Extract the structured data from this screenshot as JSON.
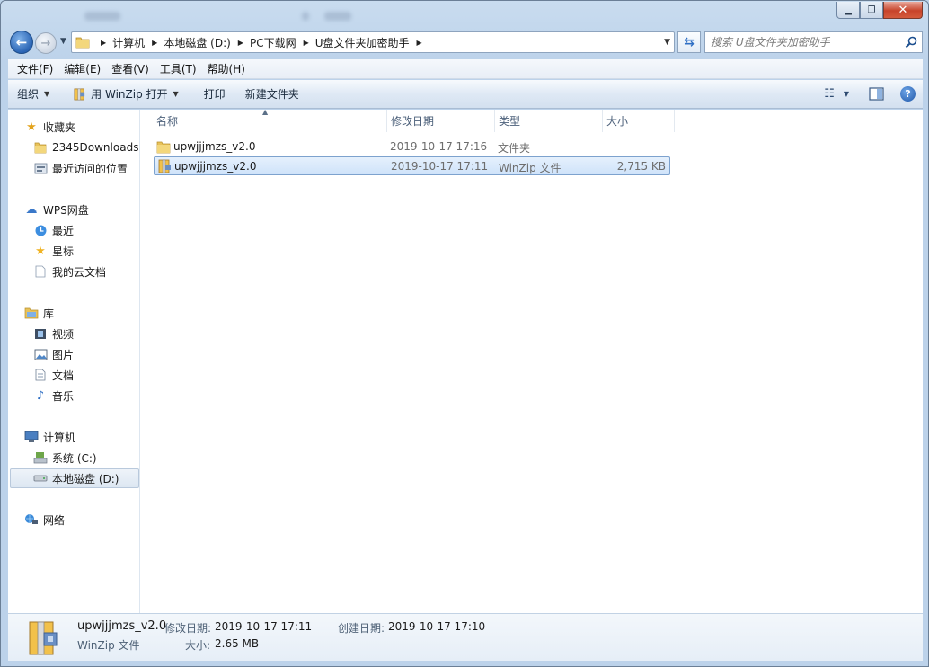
{
  "address": {
    "crumbs": [
      "计算机",
      "本地磁盘 (D:)",
      "PC下载网",
      "U盘文件夹加密助手"
    ]
  },
  "search": {
    "placeholder": "搜索 U盘文件夹加密助手"
  },
  "menubar": [
    "文件(F)",
    "编辑(E)",
    "查看(V)",
    "工具(T)",
    "帮助(H)"
  ],
  "toolbar": {
    "organize": "组织",
    "open_with": "用 WinZip 打开",
    "print": "打印",
    "new_folder": "新建文件夹"
  },
  "navpane": {
    "favorites": "收藏夹",
    "downloads": "2345Downloads",
    "recent_places": "最近访问的位置",
    "wps": "WPS网盘",
    "wps_recent": "最近",
    "wps_starred": "星标",
    "wps_docs": "我的云文档",
    "libraries": "库",
    "videos": "视频",
    "pictures": "图片",
    "documents": "文档",
    "music": "音乐",
    "computer": "计算机",
    "drive_c": "系统 (C:)",
    "drive_d": "本地磁盘 (D:)",
    "network": "网络"
  },
  "columns": {
    "name": "名称",
    "modified": "修改日期",
    "type": "类型",
    "size": "大小"
  },
  "files": [
    {
      "name": "upwjjjmzs_v2.0",
      "modified": "2019-10-17 17:16",
      "type": "文件夹",
      "size": "",
      "icon": "folder-icon"
    },
    {
      "name": "upwjjjmzs_v2.0",
      "modified": "2019-10-17 17:11",
      "type": "WinZip 文件",
      "size": "2,715 KB",
      "icon": "winzip-icon"
    }
  ],
  "details": {
    "name": "upwjjjmzs_v2.0",
    "type": "WinZip 文件",
    "modified_label": "修改日期:",
    "modified": "2019-10-17 17:11",
    "created_label": "创建日期:",
    "created": "2019-10-17 17:10",
    "size_label": "大小:",
    "size": "2.65 MB"
  },
  "colors": {
    "selection": "#cfe3fa",
    "selection_border": "#7da2ce",
    "window_frame": "#bcd2ea"
  }
}
